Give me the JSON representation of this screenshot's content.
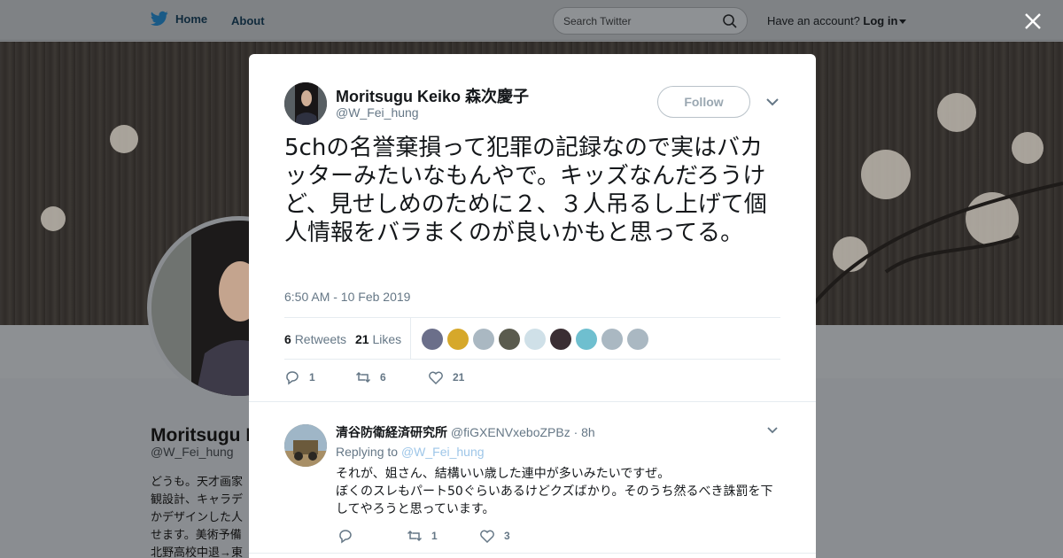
{
  "nav": {
    "home_label": "Home",
    "about_label": "About",
    "search_placeholder": "Search Twitter",
    "have_account": "Have an account?",
    "login_label": "Log in"
  },
  "profile_bg": {
    "name": "Moritsugu Keiko 森次慶子",
    "handle": "@W_Fei_hung",
    "bio": "どうも。天才画家\n観設計、キャラデ\nかデザインした人\nせます。美術予備\n北野高校中退→東"
  },
  "tweet": {
    "author_name": "Moritsugu Keiko 森次慶子",
    "author_handle": "@W_Fei_hung",
    "follow_label": "Follow",
    "text": "5chの名誉棄損って犯罪の記録なので実はバカッターみたいなもんやで。キッズなんだろうけど、見せしめのために２、３人吊るし上げて個人情報をバラまくのが良いかもと思ってる。",
    "timestamp": "6:50 AM - 10 Feb 2019",
    "retweets_count": "6",
    "retweets_label": "Retweets",
    "likes_count": "21",
    "likes_label": "Likes",
    "action_reply_count": "1",
    "action_retweet_count": "6",
    "action_like_count": "21",
    "liker_avatars": [
      "liker-1",
      "liker-2",
      "liker-3",
      "liker-4",
      "liker-5",
      "liker-6",
      "liker-7",
      "liker-8",
      "liker-9"
    ]
  },
  "reply": {
    "name": "清谷防衛経済研究所",
    "handle": "@fiGXENVxeboZPBz",
    "time": "· 8h",
    "replying_prefix": "Replying to",
    "replying_to": "@W_Fei_hung",
    "body": "それが、姐さん、結構いい歳した連中が多いみたいですぜ。\nぼくのスレもパート50ぐらいあるけどクズばかり。そのうち然るべき誅罰を下してやろうと思っています。",
    "reply_count": "",
    "retweet_count": "1",
    "like_count": "3"
  },
  "colors": {
    "twitter_blue": "#1da1f2",
    "muted_text": "#657786",
    "border": "#e6ecf0"
  }
}
